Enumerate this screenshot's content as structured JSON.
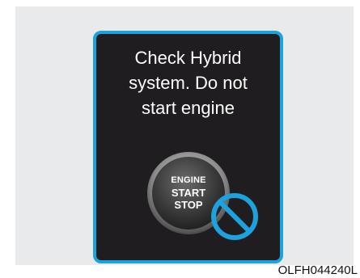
{
  "display": {
    "message_lines": [
      "Check Hybrid",
      "system. Do not",
      "start engine"
    ]
  },
  "engine_button": {
    "line1": "ENGINE",
    "line2": "START",
    "line3": "STOP"
  },
  "prohibited_icon": "no-symbol-icon",
  "figure_code": "OLFH044240L",
  "colors": {
    "display_border": "#1ca3dd",
    "display_background": "#1f1d1f",
    "text": "#ffffff",
    "prohibited_symbol": "#1ca3dd",
    "frame_background": "#e9eaec"
  }
}
